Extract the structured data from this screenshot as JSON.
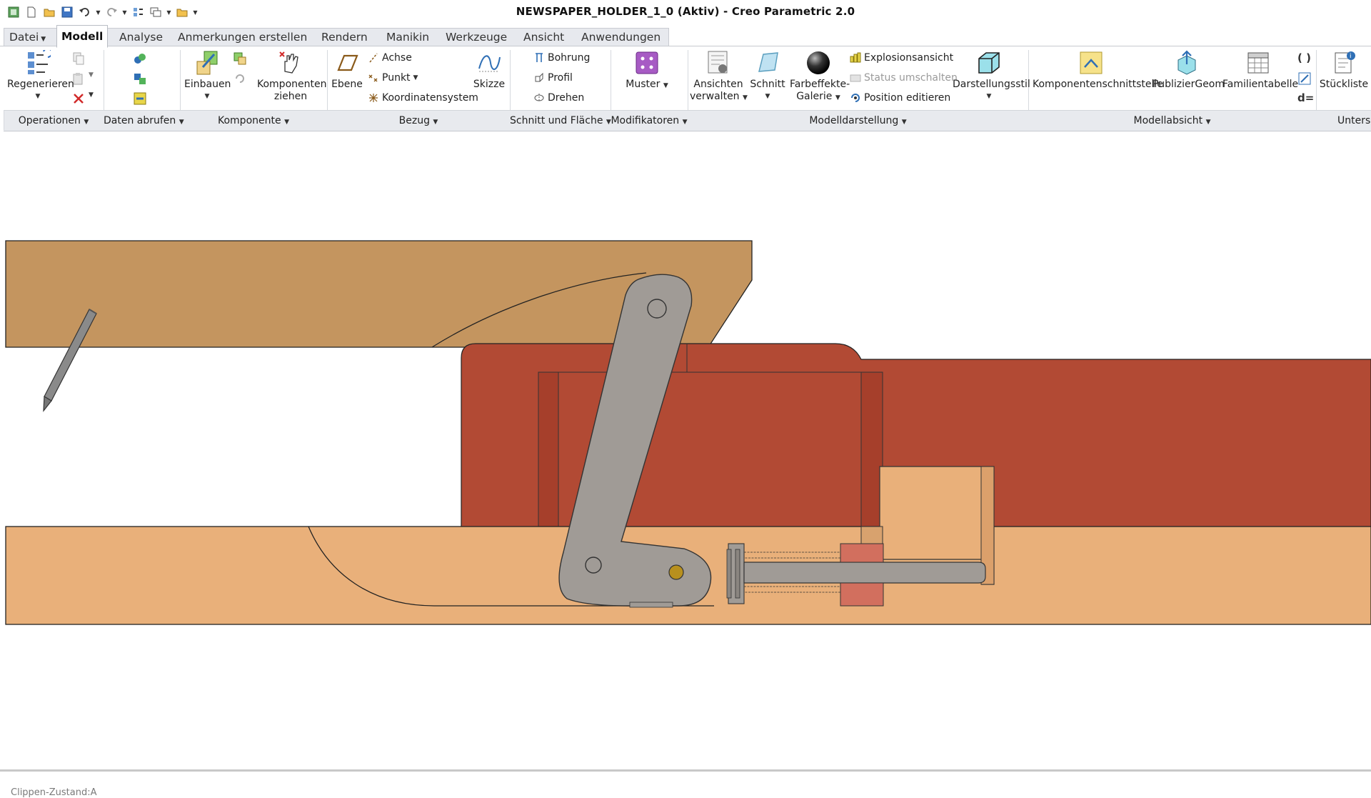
{
  "window": {
    "title": "NEWSPAPER_HOLDER_1_0 (Aktiv) - Creo Parametric 2.0"
  },
  "quick_access": {
    "icons": [
      "app-icon",
      "new-icon",
      "open-icon",
      "save-icon",
      "undo-icon",
      "redo-icon",
      "regenerate-icon",
      "windows-icon",
      "close-window-icon",
      "customize-icon"
    ]
  },
  "tabs": [
    {
      "label": "Datei",
      "active": false
    },
    {
      "label": "Modell",
      "active": true
    },
    {
      "label": "Analyse",
      "active": false
    },
    {
      "label": "Anmerkungen erstellen",
      "active": false
    },
    {
      "label": "Rendern",
      "active": false
    },
    {
      "label": "Manikin",
      "active": false
    },
    {
      "label": "Werkzeuge",
      "active": false
    },
    {
      "label": "Ansicht",
      "active": false
    },
    {
      "label": "Anwendungen",
      "active": false
    }
  ],
  "ribbon": {
    "operationen": {
      "regenerieren": "Regenerieren"
    },
    "komponente": {
      "einbauen": "Einbauen",
      "komponenten_ziehen_1": "Komponenten",
      "komponenten_ziehen_2": "ziehen"
    },
    "bezug": {
      "ebene": "Ebene",
      "achse": "Achse",
      "punkt": "Punkt",
      "koordinatensystem": "Koordinatensystem",
      "skizze": "Skizze"
    },
    "schnitt_flaeche": {
      "bohrung": "Bohrung",
      "profil": "Profil",
      "drehen": "Drehen"
    },
    "modifikatoren": {
      "muster": "Muster"
    },
    "modelldarstellung": {
      "ansichten_verwalten_1": "Ansichten",
      "ansichten_verwalten_2": "verwalten",
      "schnitt": "Schnitt",
      "farbeffekte_1": "Farbeffekte-",
      "farbeffekte_2": "Galerie",
      "explosionsansicht": "Explosionsansicht",
      "status_umschalten": "Status umschalten",
      "position_editieren": "Position editieren",
      "darstellungsstil": "Darstellungsstil"
    },
    "modellabsicht": {
      "komponentenschnittstelle": "Komponentenschnittstelle",
      "publiziergeom": "PublizierGeom",
      "familientabelle": "Familientabelle",
      "stueckliste": "Stückliste",
      "relations_symbol": "d="
    }
  },
  "groups": [
    {
      "label": "Operationen"
    },
    {
      "label": "Daten abrufen"
    },
    {
      "label": "Komponente"
    },
    {
      "label": "Bezug"
    },
    {
      "label": "Schnitt und Fläche"
    },
    {
      "label": "Modifikatoren"
    },
    {
      "label": "Modelldarstellung"
    },
    {
      "label": "Modellabsicht"
    },
    {
      "label": "Untersu"
    }
  ],
  "viewport": {
    "clip_state": "Clippen-Zustand:A"
  },
  "colors": {
    "wood_light": "#e9b07a",
    "wood_dark": "#c4955f",
    "body_red": "#b24a34",
    "link_gray": "#a09b96",
    "pin_gold": "#b8901e",
    "accent_blue": "#2f6fb5"
  }
}
